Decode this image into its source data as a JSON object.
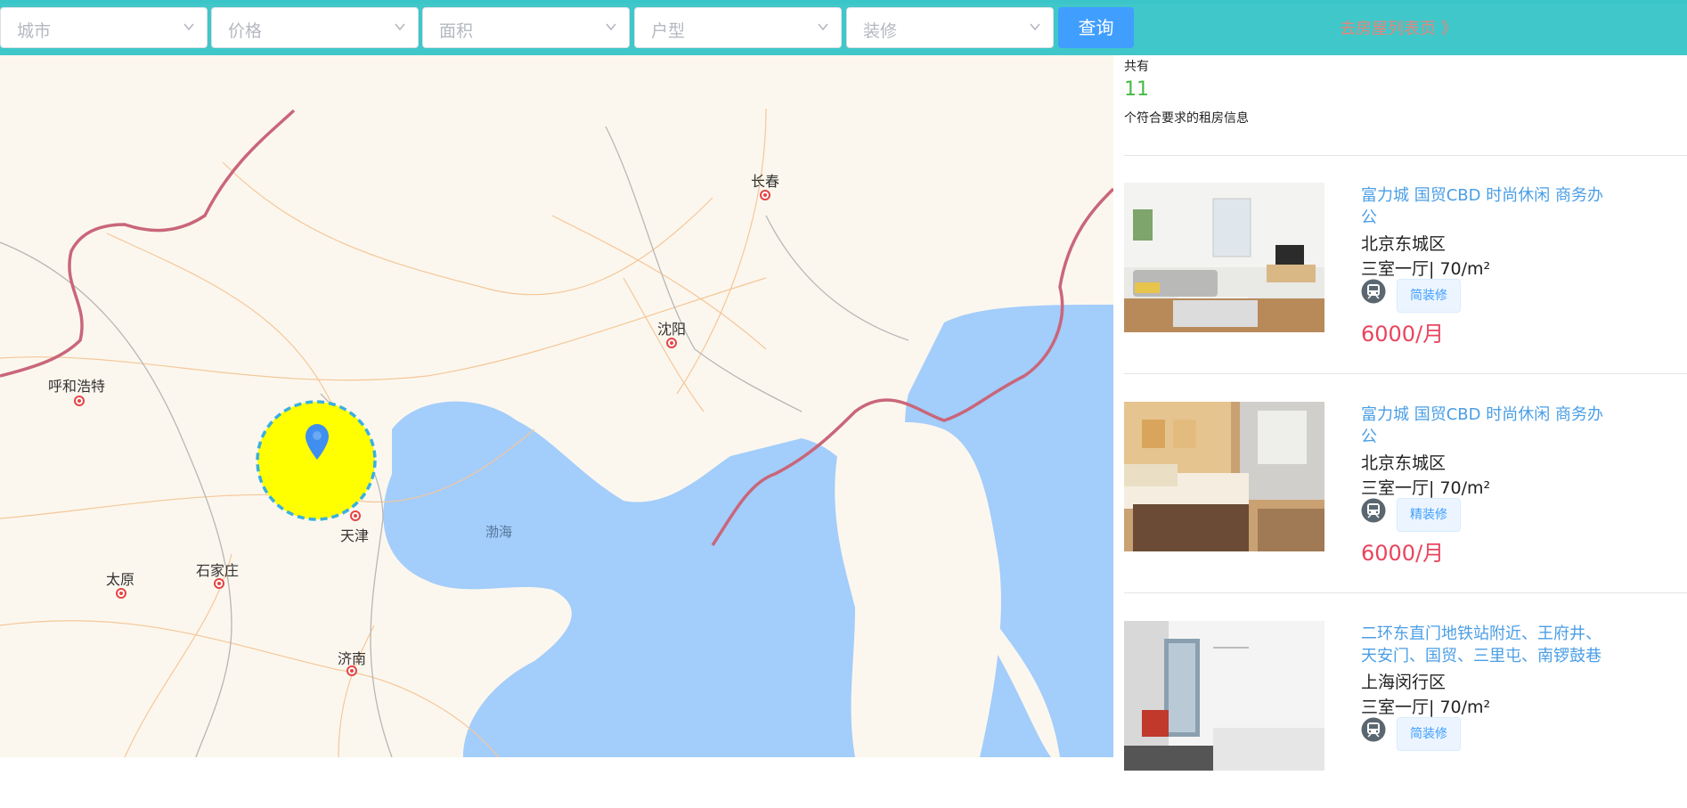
{
  "filters": {
    "city_placeholder": "城市",
    "price_placeholder": "价格",
    "area_placeholder": "面积",
    "layout_placeholder": "户型",
    "decoration_placeholder": "装修",
    "query_label": "查询",
    "list_link": "去房屋列表页 》"
  },
  "map": {
    "cities": [
      "长春",
      "沈阳",
      "呼和浩特",
      "天津",
      "太原",
      "石家庄",
      "济南"
    ],
    "sea": "渤海"
  },
  "summary": {
    "prefix": "共有",
    "count": "11",
    "suffix": "个符合要求的租房信息"
  },
  "listings": [
    {
      "title": "富力城 国贸CBD 时尚休闲 商务办公",
      "district": "北京东城区",
      "specs": "三室一厅| 70/m²",
      "tag": "简装修",
      "price": "6000/月"
    },
    {
      "title": "富力城 国贸CBD 时尚休闲 商务办公",
      "district": "北京东城区",
      "specs": "三室一厅| 70/m²",
      "tag": "精装修",
      "price": "6000/月"
    },
    {
      "title": "二环东直门地铁站附近、王府井、天安门、国贸、三里屯、南锣鼓巷",
      "district": "上海闵行区",
      "specs": "三室一厅| 70/m²",
      "tag": "简装修",
      "price": ""
    }
  ],
  "colors": {
    "topbar": "#3fc7c9",
    "query_button": "#409eff",
    "price": "#e8455e",
    "title_link": "#4a9ee6",
    "count": "#44bb44",
    "marker_circle": "#ffff00"
  },
  "icons": [
    "chevron-down-icon",
    "map-pin-icon",
    "metro-icon"
  ]
}
